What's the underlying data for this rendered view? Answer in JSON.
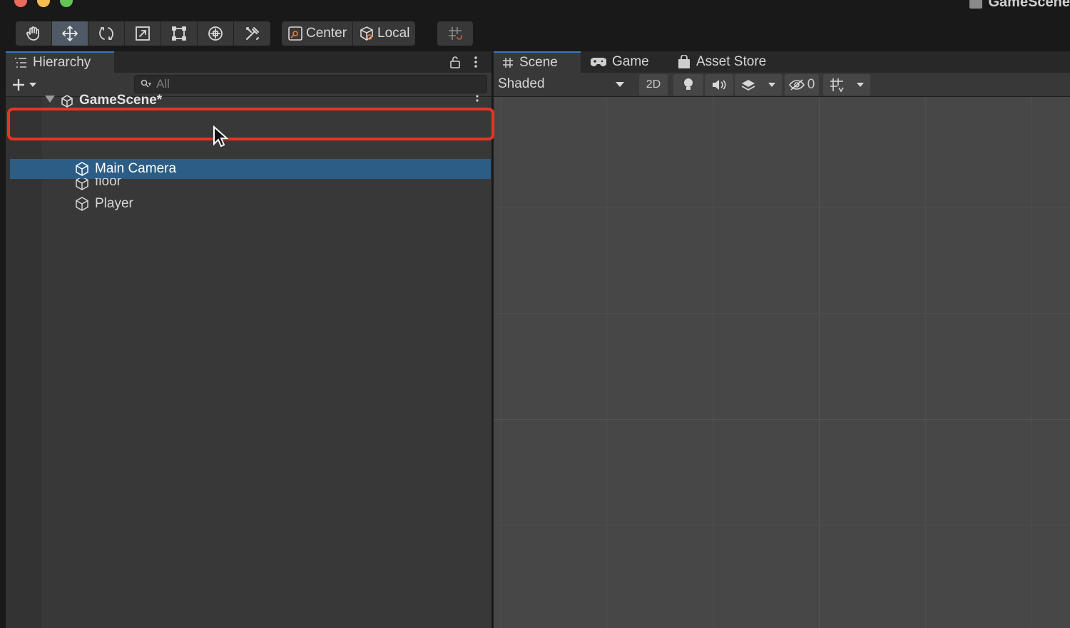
{
  "window": {
    "title": "GameScene"
  },
  "toolbar": {
    "tools": [
      {
        "name": "hand-tool",
        "icon": "hand-icon"
      },
      {
        "name": "move-tool",
        "icon": "move-arrows-icon",
        "active": true
      },
      {
        "name": "rotate-tool",
        "icon": "rotate-icon"
      },
      {
        "name": "scale-tool",
        "icon": "scale-icon"
      },
      {
        "name": "rect-tool",
        "icon": "rect-transform-icon"
      },
      {
        "name": "transform-tool",
        "icon": "transform-icon"
      },
      {
        "name": "custom-tool",
        "icon": "tools-icon"
      }
    ],
    "pivot_label": "Center",
    "space_label": "Local"
  },
  "hierarchy": {
    "tab_label": "Hierarchy",
    "search_placeholder": "All",
    "scene_name": "GameScene*",
    "items": [
      {
        "label": "Main Camera",
        "selected": true
      },
      {
        "label": "floor",
        "selected": false
      },
      {
        "label": "Player",
        "selected": false
      }
    ]
  },
  "scene_view": {
    "tabs": [
      {
        "label": "Scene",
        "icon": "grid-hash-icon",
        "active": true
      },
      {
        "label": "Game",
        "icon": "gamepad-icon",
        "active": false
      },
      {
        "label": "Asset Store",
        "icon": "shopping-bag-icon",
        "active": false
      }
    ],
    "draw_mode": "Shaded",
    "mode_2d_label": "2D",
    "hidden_count": "0"
  },
  "colors": {
    "selection": "#2c5d87",
    "highlight_box": "#ea3323",
    "tab_accent": "#3a79bb"
  }
}
